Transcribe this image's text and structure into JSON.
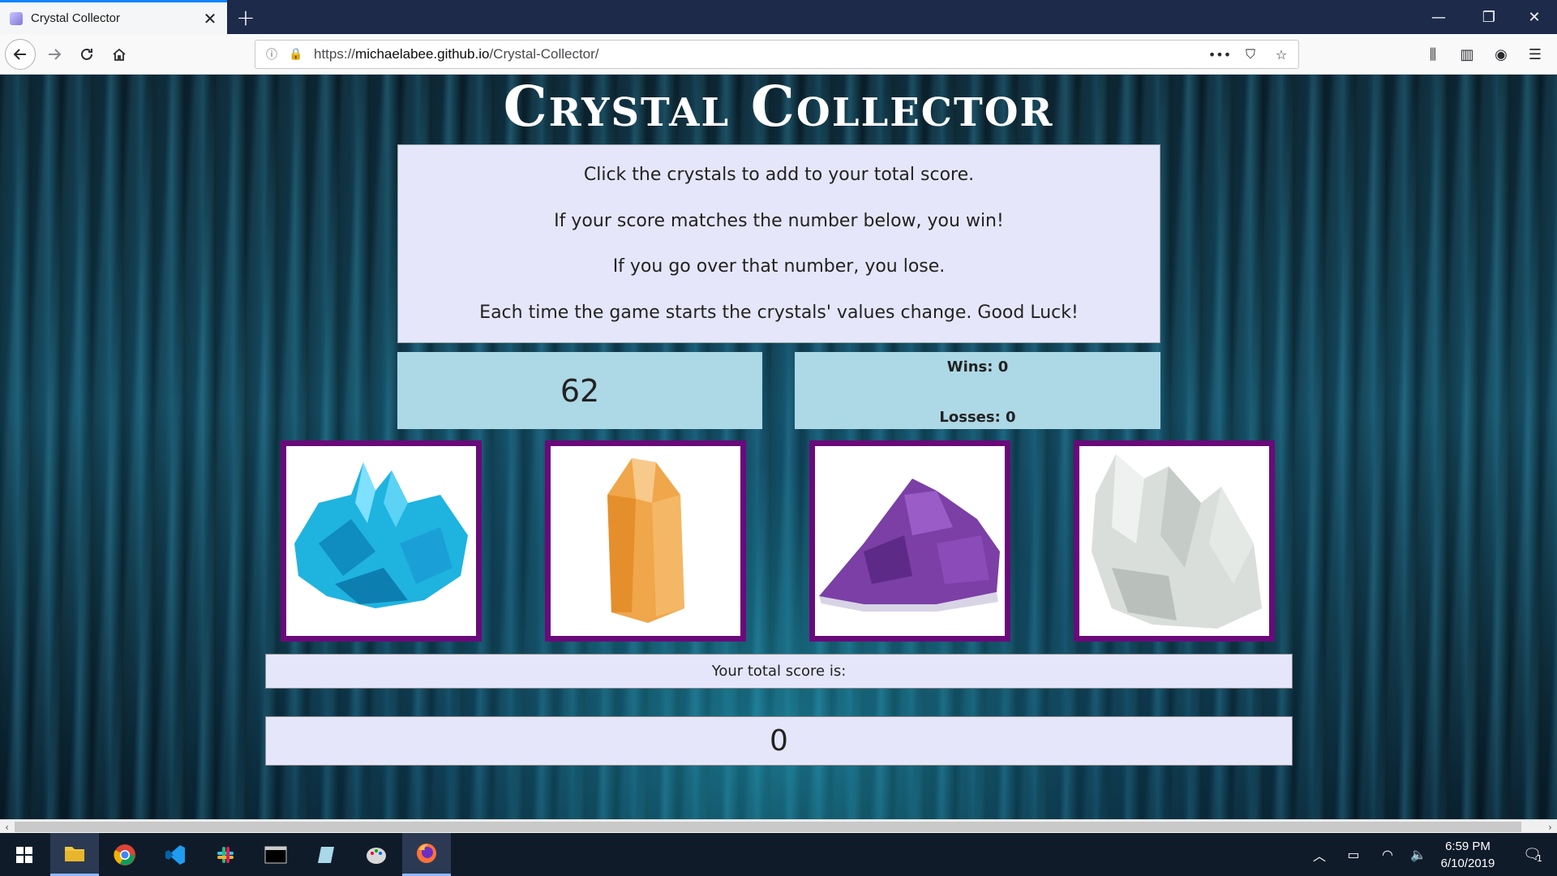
{
  "browser": {
    "tab_title": "Crystal Collector",
    "url_prefix": "https://",
    "url_host": "michaelabee.github.io",
    "url_path": "/Crystal-Collector/"
  },
  "page": {
    "title": "Crystal Collector",
    "instructions": [
      "Click the crystals to add to your total score.",
      "If your score matches the number below, you win!",
      "If you go over that number, you lose.",
      "Each time the game starts the crystals' values change. Good Luck!"
    ],
    "target_number": "62",
    "wins_text": "Wins: 0",
    "losses_text": "Losses: 0",
    "crystals": [
      {
        "name": "blue crystal",
        "color": "#1fb3e0"
      },
      {
        "name": "orange crystal",
        "color": "#f0a64a"
      },
      {
        "name": "purple crystal",
        "color": "#7b3fa6"
      },
      {
        "name": "clear crystal",
        "color": "#d9dedb"
      }
    ],
    "score_label": "Your total score is:",
    "score_value": "0"
  },
  "taskbar": {
    "time": "6:59 PM",
    "date": "6/10/2019",
    "notification_count": "1"
  },
  "colors": {
    "info_box": "#e6e6fa",
    "counter_box": "#add8e6",
    "crystal_border": "#6a0a7a"
  }
}
